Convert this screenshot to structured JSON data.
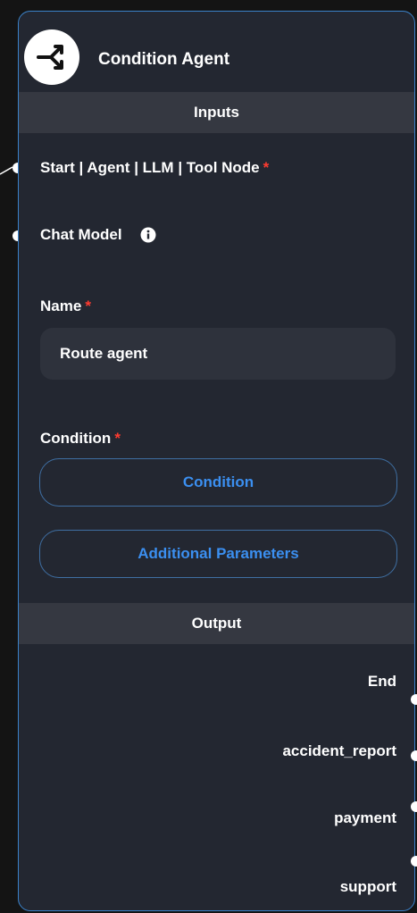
{
  "node": {
    "title": "Condition Agent",
    "icon": "split-arrow-icon"
  },
  "sections": {
    "inputs": "Inputs",
    "output": "Output"
  },
  "inputs": {
    "start_label": "Start | Agent | LLM | Tool Node",
    "chat_model_label": "Chat Model",
    "required_mark": "*"
  },
  "fields": {
    "name_label": "Name",
    "name_value": "Route agent",
    "condition_label": "Condition",
    "condition_button": "Condition",
    "additional_params_button": "Additional Parameters"
  },
  "outputs": [
    "End",
    "accident_report",
    "payment",
    "support"
  ],
  "colors": {
    "background": "#141414",
    "node": "#232731",
    "section_bar": "#353841",
    "accent": "#3b8ff0",
    "required": "#ff3b30",
    "border": "#3b82c9"
  }
}
